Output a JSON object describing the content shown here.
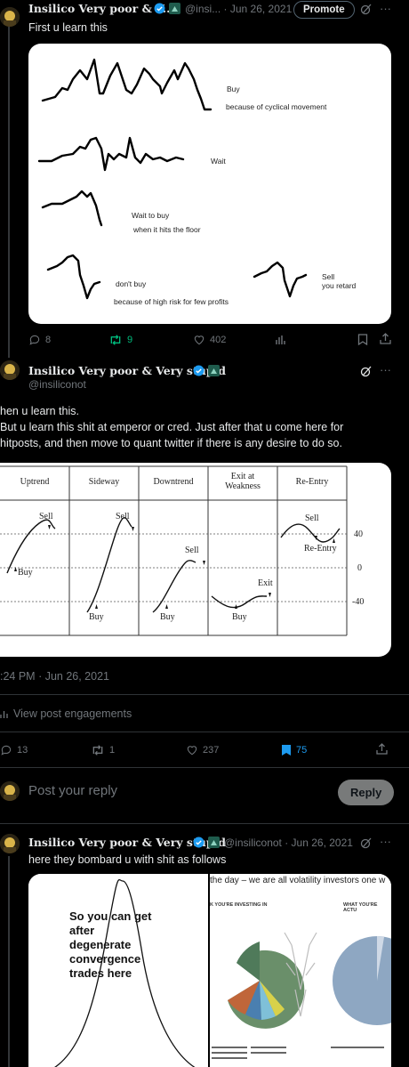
{
  "tweet1": {
    "name": "Insilico Very poor & V...",
    "handle": "@insi... · Jun 26, 2021",
    "promote_label": "Promote",
    "text": "First u learn this",
    "image_labels": {
      "buy": "Buy",
      "buy_reason": "because of cyclical movement",
      "wait": "Wait",
      "wait_to_buy": "Wait to buy",
      "wait_to_buy_reason": "when it hits the floor",
      "dont_buy": "don't buy",
      "dont_buy_reason": "because of high risk for few profits",
      "sell": "Sell",
      "sell_reason": "you retard"
    },
    "replies": "8",
    "reposts": "9",
    "likes": "402"
  },
  "tweet2": {
    "name": "Insilico Very poor & Very stupid",
    "handle": "@insiliconot",
    "line1": "hen u learn this.",
    "line2": "But u learn this shit at emperor or cred. Just after that u come here for",
    "line3": "hitposts, and then move to quant twitter if there is any desire to do so.",
    "table_headers": [
      "Uptrend",
      "Sideway",
      "Downtrend",
      "Exit at Weakness",
      "Re-Entry"
    ],
    "chart_labels": {
      "sell": "Sell",
      "buy": "Buy",
      "exit": "Exit",
      "re_entry": "Re-Entry",
      "level_40": "40",
      "level_0": "0",
      "level_neg40": "-40"
    },
    "timestamp": ":24 PM · Jun 26, 2021",
    "engagements": "View post engagements",
    "replies": "13",
    "reposts": "1",
    "likes": "237",
    "bookmarks": "75"
  },
  "reply_box": {
    "placeholder": "Post your reply",
    "button": "Reply"
  },
  "tweet3": {
    "name": "Insilico Very poor & Very stupid",
    "handle": "@insiliconot · Jun 26, 2021",
    "text": "here they bombard u with shit as follows",
    "left_image_text": "So you can get after degenerate convergence trades here",
    "right_header": "the day – we are all volatility investors one w",
    "right_col1": "K YOU'RE INVESTING IN",
    "right_col2": "WHAT YOU'RE ACTU"
  },
  "colors": {
    "accent": "#1d9bf0",
    "repost_green": "#00ba7c",
    "muted": "#71767b"
  }
}
